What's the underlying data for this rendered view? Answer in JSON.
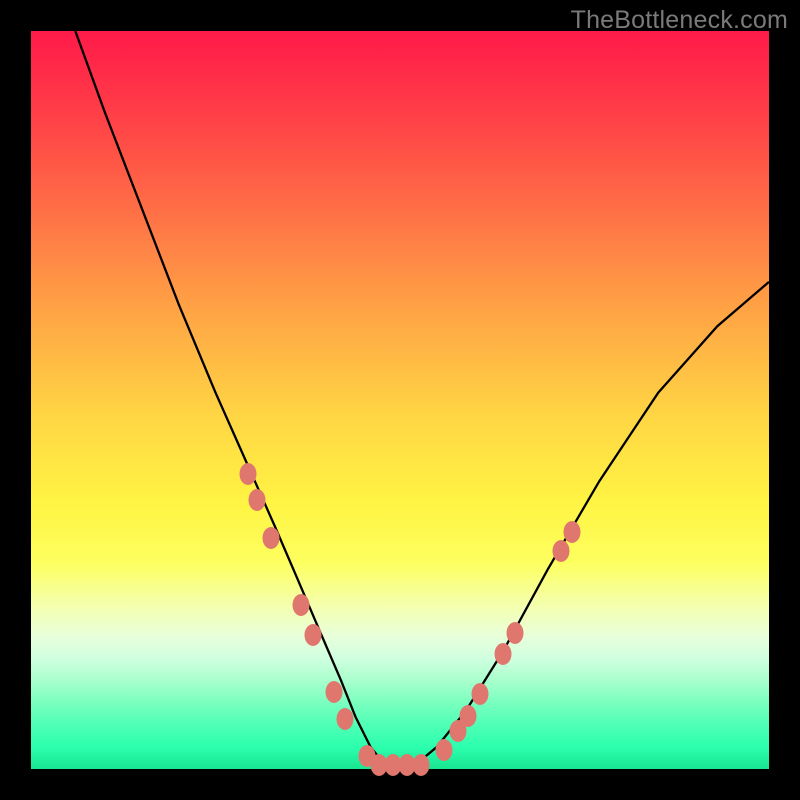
{
  "watermark": "TheBottleneck.com",
  "chart_data": {
    "type": "line",
    "title": "",
    "xlabel": "",
    "ylabel": "",
    "xlim": [
      0,
      100
    ],
    "ylim": [
      0,
      100
    ],
    "series": [
      {
        "name": "curve",
        "x": [
          6,
          10,
          15,
          20,
          25,
          29,
          33,
          36,
          39,
          42,
          44,
          46,
          48,
          52,
          55,
          59,
          64,
          70,
          77,
          85,
          93,
          100
        ],
        "y": [
          100,
          89,
          76,
          63,
          51,
          42,
          33,
          26,
          19,
          12,
          7,
          3,
          0.5,
          0.5,
          3,
          8,
          16,
          27,
          39,
          51,
          60,
          66
        ]
      }
    ],
    "markers": [
      {
        "x": 29.4,
        "y": 40.0
      },
      {
        "x": 30.6,
        "y": 36.4
      },
      {
        "x": 32.5,
        "y": 31.3
      },
      {
        "x": 36.6,
        "y": 22.2
      },
      {
        "x": 38.2,
        "y": 18.1
      },
      {
        "x": 41.1,
        "y": 10.4
      },
      {
        "x": 42.6,
        "y": 6.8
      },
      {
        "x": 45.5,
        "y": 1.7
      },
      {
        "x": 47.1,
        "y": 0.6
      },
      {
        "x": 49.0,
        "y": 0.6
      },
      {
        "x": 51.0,
        "y": 0.6
      },
      {
        "x": 52.9,
        "y": 0.6
      },
      {
        "x": 56.0,
        "y": 2.6
      },
      {
        "x": 57.8,
        "y": 5.1
      },
      {
        "x": 59.2,
        "y": 7.2
      },
      {
        "x": 60.9,
        "y": 10.2
      },
      {
        "x": 64.0,
        "y": 15.6
      },
      {
        "x": 65.6,
        "y": 18.4
      },
      {
        "x": 71.8,
        "y": 29.5
      },
      {
        "x": 73.3,
        "y": 32.1
      }
    ],
    "gradient_stops": [
      {
        "pos": 0,
        "color": "#ff1a49"
      },
      {
        "pos": 100,
        "color": "#18e590"
      }
    ]
  }
}
